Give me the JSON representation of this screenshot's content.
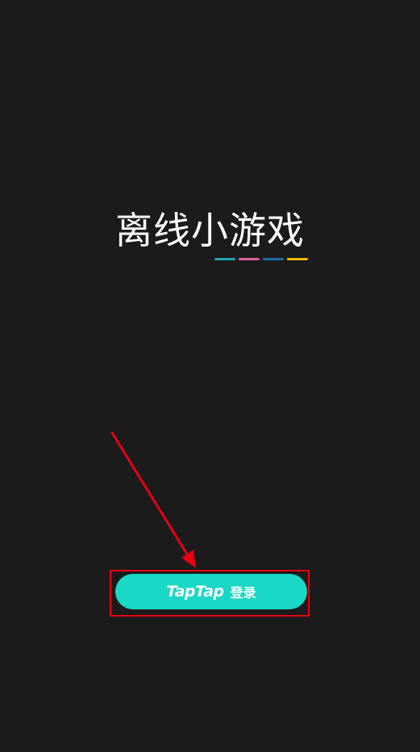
{
  "app": {
    "title": "离线小游戏"
  },
  "title_underline": {
    "colors": [
      "#1fa3b8",
      "#d9609d",
      "#1e6aa8",
      "#f2b705"
    ]
  },
  "login_button": {
    "brand": "TapTap",
    "label": "登录",
    "color": "#19d8c5"
  },
  "annotation": {
    "color": "#e60012",
    "icon": "arrow-pointer-icon"
  }
}
